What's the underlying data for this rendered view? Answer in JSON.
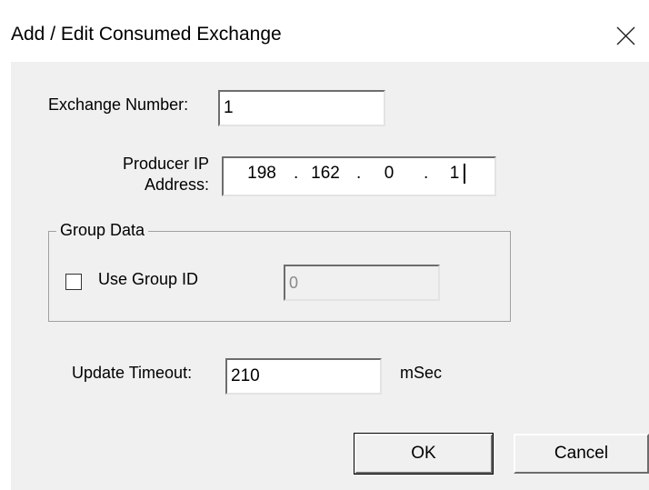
{
  "window": {
    "title": "Add / Edit Consumed Exchange"
  },
  "form": {
    "exchange_number_label": "Exchange Number:",
    "exchange_number_value": "1",
    "producer_ip_label_line1": "Producer IP",
    "producer_ip_label_line2": "Address:",
    "producer_ip_octets": [
      "198",
      "162",
      "0",
      "1"
    ],
    "group_data": {
      "legend": "Group Data",
      "use_group_id_label": "Use Group ID",
      "use_group_id_checked": false,
      "group_id_value": "0"
    },
    "update_timeout_label": "Update Timeout:",
    "update_timeout_value": "210",
    "update_timeout_unit": "mSec"
  },
  "buttons": {
    "ok_label": "OK",
    "cancel_label": "Cancel"
  },
  "icons": {
    "close": "close-icon"
  }
}
